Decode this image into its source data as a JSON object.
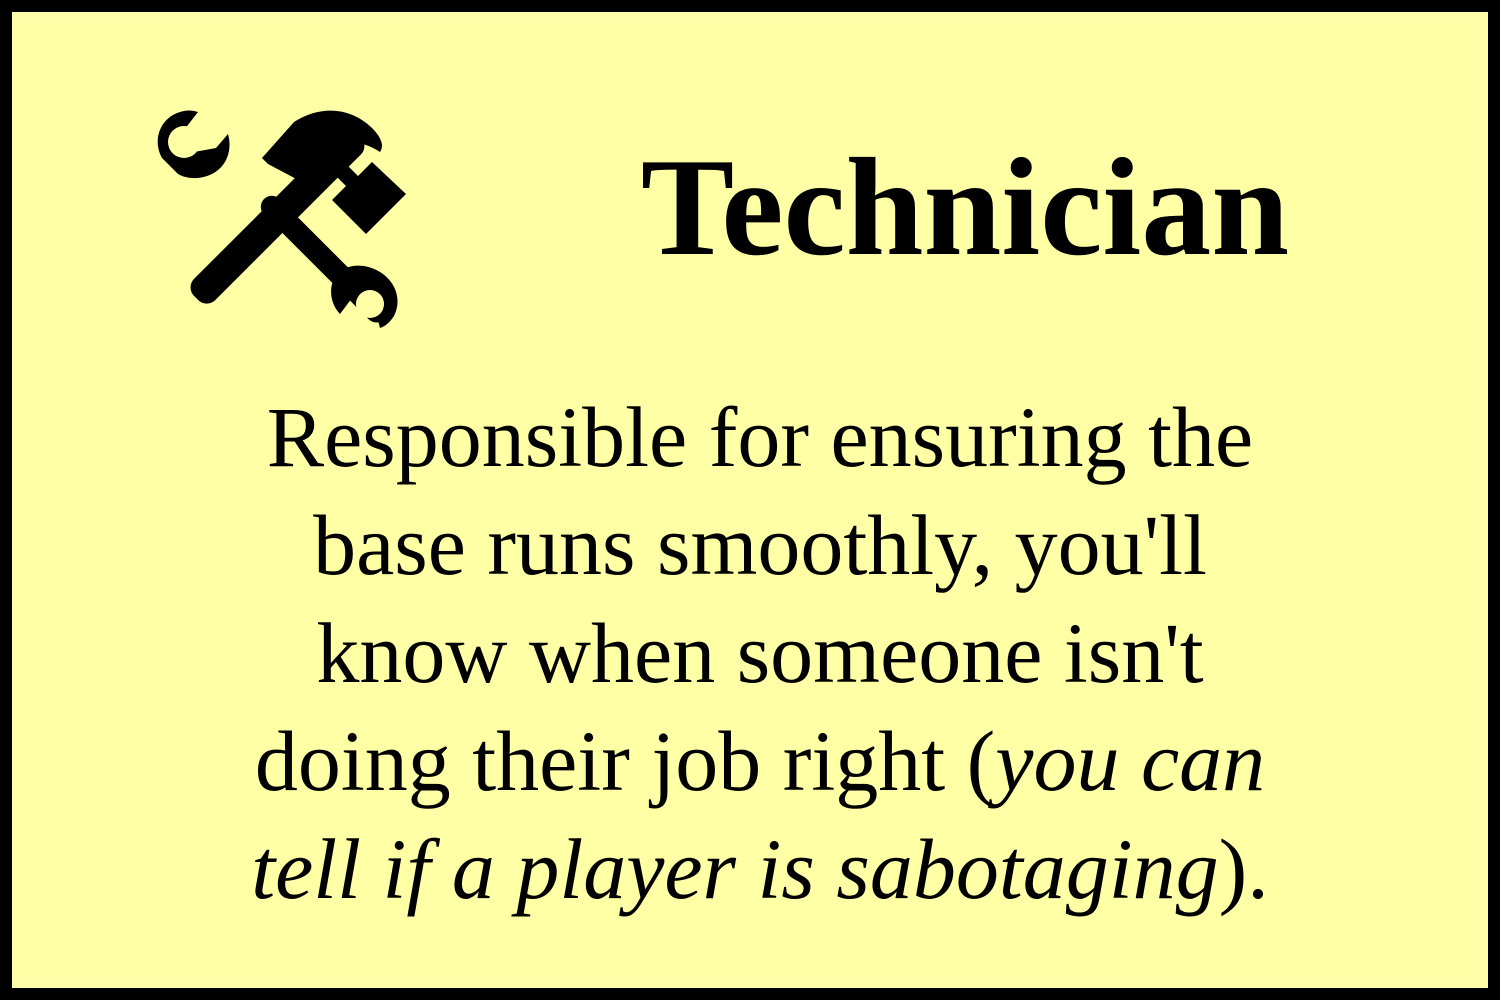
{
  "card": {
    "icon": "hammer-and-wrench-icon",
    "title": "Technician",
    "description": {
      "lines": [
        "Responsible for ensuring the",
        "base runs smoothly, you'll",
        "know when someone isn't"
      ],
      "line4_plain": "doing their job right (",
      "line4_italic": "you can",
      "line5_italic": "tell if a player is sabotaging",
      "line5_plain": ")."
    }
  }
}
